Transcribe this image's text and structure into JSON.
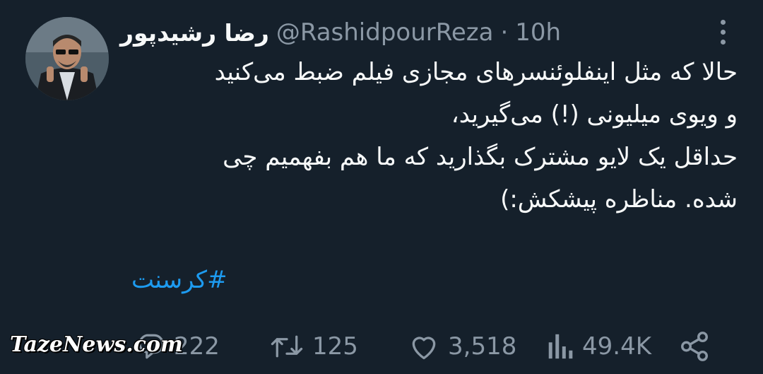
{
  "tweet": {
    "author": {
      "display_name": "رضا رشیدپور",
      "handle": "@RashidpourReza",
      "avatar_icon": "profile-photo"
    },
    "separator": "·",
    "time": "10h",
    "body_lines": [
      "حالا که مثل اینفلوئنسرهای مجازی فیلم ضبط می‌کنید",
      "و ویوی میلیونی (!) می‌گیرید،",
      "حداقل یک لایو مشترک بگذارید که ما هم بفهمیم چی",
      "شده. مناظره پیشکش:)"
    ],
    "hashtag": "#کرسنت",
    "stats": {
      "replies": "222",
      "retweets": "125",
      "likes": "3,518",
      "views": "49.4K"
    }
  },
  "watermark": "TazeNews.com",
  "colors": {
    "background": "#15202b",
    "text": "#f7f9f9",
    "muted": "#8b98a5",
    "accent": "#1d9bf0"
  }
}
